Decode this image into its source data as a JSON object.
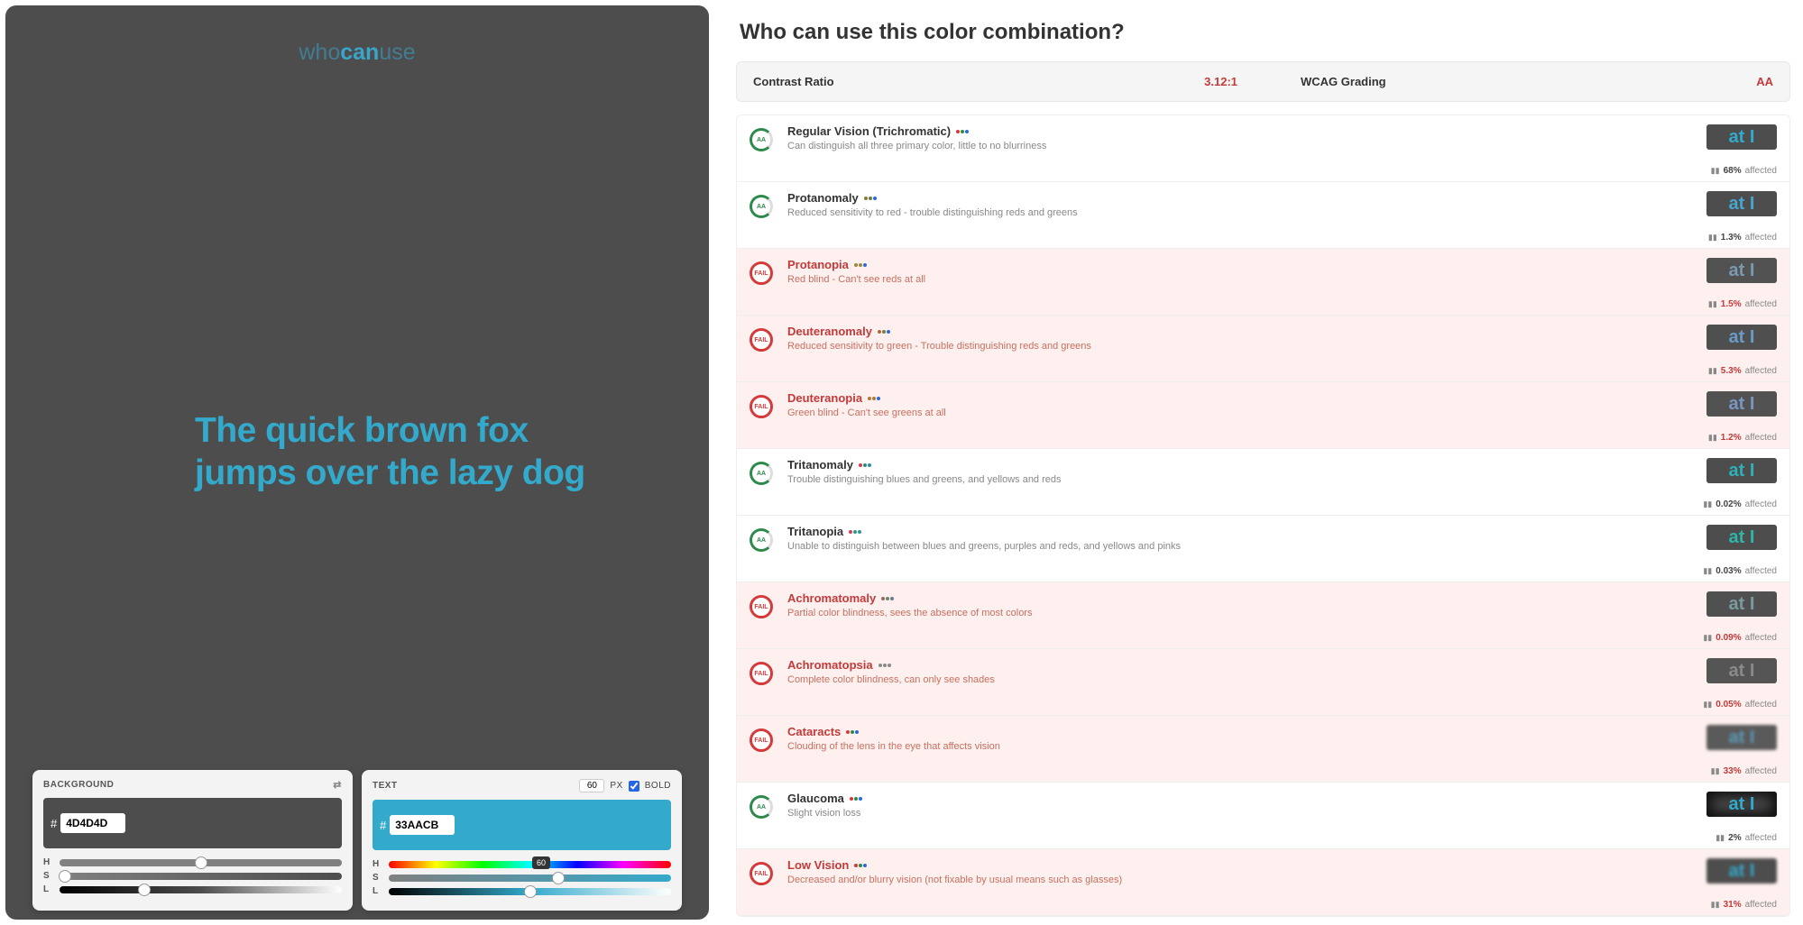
{
  "logo": {
    "who": "who",
    "can": "can",
    "use": "use"
  },
  "preview": {
    "text": "The quick brown fox jumps over the lazy dog"
  },
  "background_panel": {
    "label": "BACKGROUND",
    "hex": "4D4D4D",
    "sliders": {
      "h": "H",
      "s": "S",
      "l": "L"
    }
  },
  "text_panel": {
    "label": "TEXT",
    "hex": "33AACB",
    "size_value": "60",
    "size_unit": "PX",
    "bold_label": "BOLD",
    "sliders": {
      "h": "H",
      "s": "S",
      "l": "L"
    },
    "hue_tooltip": "60"
  },
  "title": "Who can use this color combination?",
  "info": {
    "contrast_label": "Contrast Ratio",
    "contrast_value": "3.12:1",
    "wcag_label": "WCAG Grading",
    "wcag_value": "AA"
  },
  "badge_text": {
    "pass": "AA",
    "fail": "FAIL"
  },
  "affected_suffix": "affected",
  "swatch_text": "at I",
  "vision_types": [
    {
      "name": "Regular Vision (Trichromatic)",
      "desc": "Can distinguish all three primary color, little to no blurriness",
      "status": "pass",
      "pct": "68%",
      "swatch_bg": "#4d4d4d",
      "swatch_fg": "#33aacb",
      "dots": [
        "#d43a3a",
        "#2d8a4a",
        "#2b6ad4"
      ]
    },
    {
      "name": "Protanomaly",
      "desc": "Reduced sensitivity to red - trouble distinguishing reds and greens",
      "status": "pass",
      "pct": "1.3%",
      "swatch_bg": "#4d4d4d",
      "swatch_fg": "#4aa5ce",
      "dots": [
        "#8a7a3a",
        "#707a3a",
        "#2b6ad4"
      ]
    },
    {
      "name": "Protanopia",
      "desc": "Red blind - Can't see reds at all",
      "status": "fail",
      "pct": "1.5%",
      "swatch_bg": "#525252",
      "swatch_fg": "#7a9ab0",
      "dots": [
        "#9a8a3a",
        "#9a8a3a",
        "#2b6ad4"
      ]
    },
    {
      "name": "Deuteranomaly",
      "desc": "Reduced sensitivity to green - Trouble distinguishing reds and greens",
      "status": "fail",
      "pct": "5.3%",
      "swatch_bg": "#4f4f4f",
      "swatch_fg": "#6a9bc8",
      "dots": [
        "#b06a3a",
        "#8a7a3a",
        "#2b6ad4"
      ]
    },
    {
      "name": "Deuteranopia",
      "desc": "Green blind - Can't see greens at all",
      "status": "fail",
      "pct": "1.2%",
      "swatch_bg": "#525252",
      "swatch_fg": "#7a95c0",
      "dots": [
        "#b07a3a",
        "#b07a3a",
        "#2b6ad4"
      ]
    },
    {
      "name": "Tritanomaly",
      "desc": "Trouble distinguishing blues and greens, and yellows and reds",
      "status": "pass",
      "pct": "0.02%",
      "swatch_bg": "#4d4d4d",
      "swatch_fg": "#30b0b8",
      "dots": [
        "#d43a4a",
        "#2d8a7a",
        "#2b8aa4"
      ]
    },
    {
      "name": "Tritanopia",
      "desc": "Unable to distinguish between blues and greens, purples and reds, and yellows and pinks",
      "status": "pass",
      "pct": "0.03%",
      "swatch_bg": "#4d4d4d",
      "swatch_fg": "#2eb5a8",
      "dots": [
        "#d43a5a",
        "#2d9a8a",
        "#2b9a94"
      ]
    },
    {
      "name": "Achromatomaly",
      "desc": "Partial color blindness, sees the absence of most colors",
      "status": "fail",
      "pct": "0.09%",
      "swatch_bg": "#505050",
      "swatch_fg": "#7a9aa0",
      "dots": [
        "#9a6a6a",
        "#6a8a6a",
        "#6a7a9a"
      ]
    },
    {
      "name": "Achromatopsia",
      "desc": "Complete color blindness, can only see shades",
      "status": "fail",
      "pct": "0.05%",
      "swatch_bg": "#555",
      "swatch_fg": "#8a8a8a",
      "dots": [
        "#888",
        "#888",
        "#888"
      ]
    },
    {
      "name": "Cataracts",
      "desc": "Clouding of the lens in the eye that affects vision",
      "status": "fail",
      "pct": "33%",
      "swatch_bg": "#5a5a5a",
      "swatch_fg": "#5a9ab8",
      "dots": [
        "#d43a3a",
        "#2d8a4a",
        "#2b6ad4"
      ],
      "blur": true
    },
    {
      "name": "Glaucoma",
      "desc": "Slight vision loss",
      "status": "pass",
      "pct": "2%",
      "swatch_bg": "#4d4d4d",
      "swatch_fg": "#33aacb",
      "dots": [
        "#d43a3a",
        "#2d8a4a",
        "#2b6ad4"
      ],
      "dark_edge": true
    },
    {
      "name": "Low Vision",
      "desc": "Decreased and/or blurry vision (not fixable by usual means such as glasses)",
      "status": "fail",
      "pct": "31%",
      "swatch_bg": "#4d4d4d",
      "swatch_fg": "#33aacb",
      "dots": [
        "#d43a3a",
        "#2d8a4a",
        "#2b6ad4"
      ],
      "blur": true
    }
  ]
}
